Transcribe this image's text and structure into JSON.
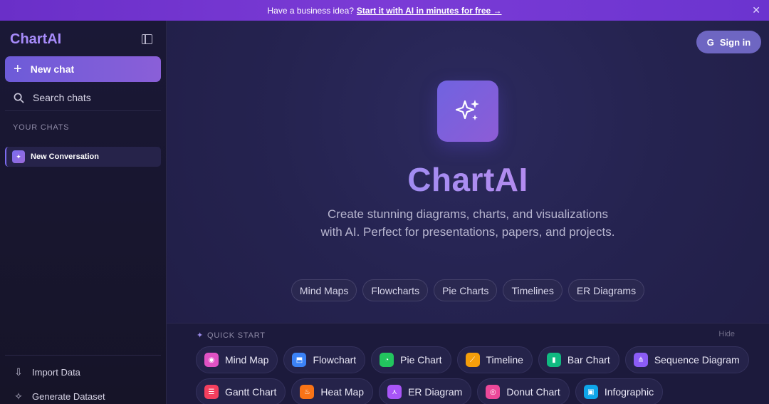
{
  "banner": {
    "text": "Have a business idea?",
    "link": "Start it with AI in minutes for free →",
    "close_icon": "close-icon"
  },
  "sidebar": {
    "brand": "ChartAI",
    "new_chat": "New chat",
    "search_chats": "Search chats",
    "section_label": "YOUR CHATS",
    "conversations": [
      {
        "label": "New Conversation"
      }
    ],
    "bottom_items": [
      {
        "label": "Import Data",
        "icon": "import-icon"
      },
      {
        "label": "Generate Dataset",
        "icon": "sparkle-icon"
      }
    ]
  },
  "header": {
    "signin": "Sign in",
    "signin_icon": "google-icon"
  },
  "hero": {
    "title": "ChartAI",
    "subtitle": "Create stunning diagrams, charts, and visualizations with AI. Perfect for presentations, papers, and projects.",
    "tags": [
      "Mind Maps",
      "Flowcharts",
      "Pie Charts",
      "Timelines",
      "ER Diagrams"
    ]
  },
  "quick_start": {
    "label": "QUICK START",
    "hide": "Hide",
    "row1": [
      {
        "label": "Mind Map",
        "color": "#e052c4",
        "icon": "mind-map-icon"
      },
      {
        "label": "Flowchart",
        "color": "#3b82f6",
        "icon": "flowchart-icon"
      },
      {
        "label": "Pie Chart",
        "color": "#22c55e",
        "icon": "pie-chart-icon"
      },
      {
        "label": "Timeline",
        "color": "#f59e0b",
        "icon": "timeline-icon"
      },
      {
        "label": "Bar Chart",
        "color": "#10b981",
        "icon": "bar-chart-icon"
      },
      {
        "label": "Sequence Diagram",
        "color": "#8b5cf6",
        "icon": "sequence-diagram-icon"
      }
    ],
    "row2": [
      {
        "label": "Gantt Chart",
        "color": "#f43f5e",
        "icon": "gantt-chart-icon"
      },
      {
        "label": "Heat Map",
        "color": "#f97316",
        "icon": "heat-map-icon"
      },
      {
        "label": "ER Diagram",
        "color": "#a855f7",
        "icon": "er-diagram-icon"
      },
      {
        "label": "Donut Chart",
        "color": "#ec4899",
        "icon": "donut-chart-icon"
      },
      {
        "label": "Infographic",
        "color": "#0ea5e9",
        "icon": "infographic-icon"
      }
    ]
  }
}
